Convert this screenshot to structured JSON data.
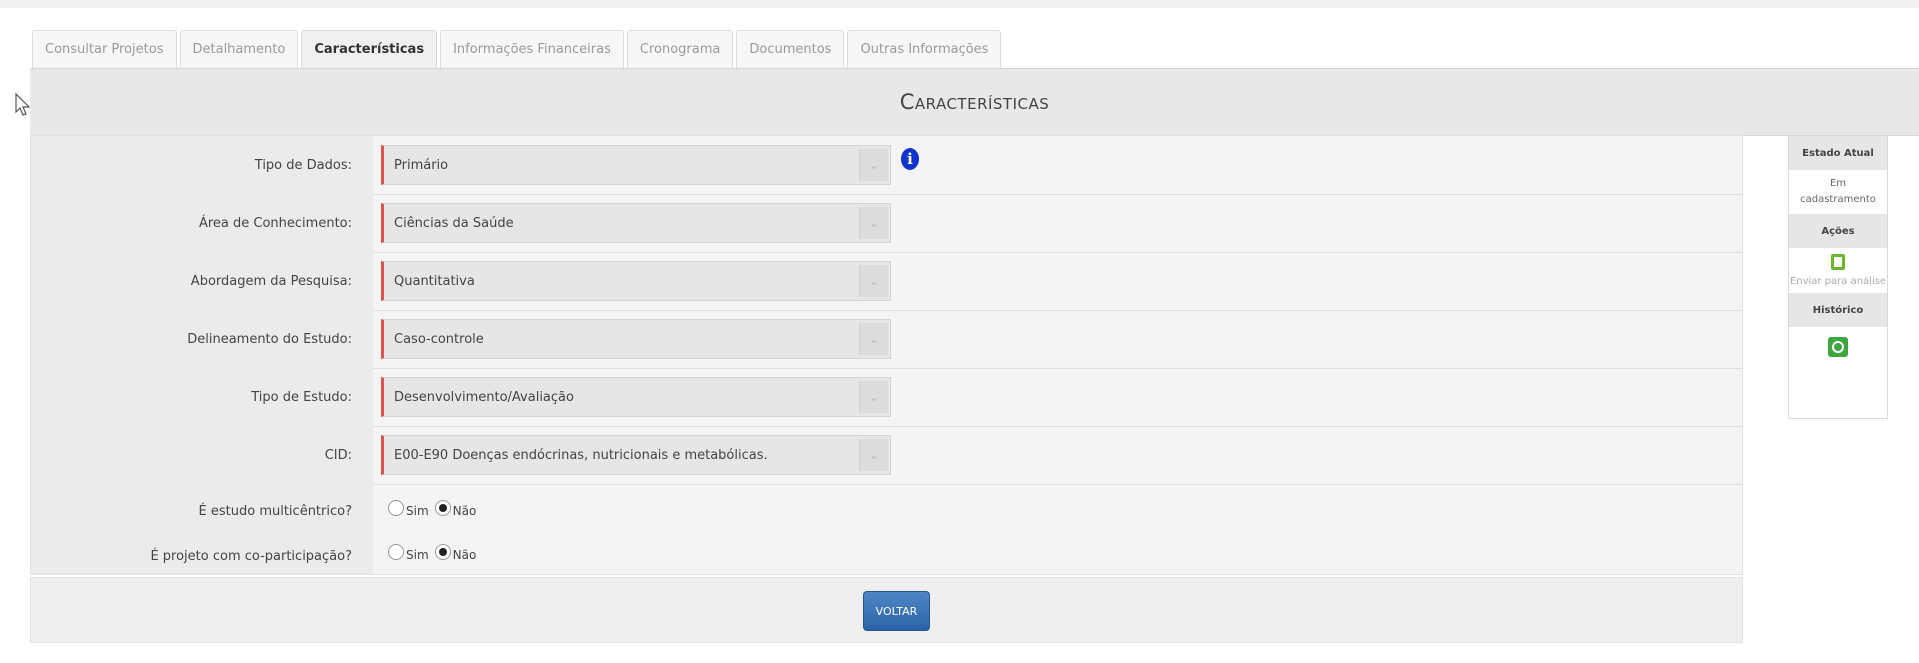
{
  "tabs": [
    {
      "label": "Consultar Projetos"
    },
    {
      "label": "Detalhamento"
    },
    {
      "label": "Características"
    },
    {
      "label": "Informações Financeiras"
    },
    {
      "label": "Cronograma"
    },
    {
      "label": "Documentos"
    },
    {
      "label": "Outras Informações"
    }
  ],
  "header": {
    "title": "Características"
  },
  "form": {
    "fields": [
      {
        "label": "Tipo de Dados:",
        "value": "Primário"
      },
      {
        "label": "Área de Conhecimento:",
        "value": "Ciências da Saúde"
      },
      {
        "label": "Abordagem da Pesquisa:",
        "value": "Quantitativa"
      },
      {
        "label": "Delineamento do Estudo:",
        "value": "Caso-controle"
      },
      {
        "label": "Tipo de Estudo:",
        "value": "Desenvolvimento/Avaliação"
      },
      {
        "label": "CID:",
        "value": "E00-E90 Doenças endócrinas, nutricionais e metabólicas."
      }
    ],
    "radios": [
      {
        "label": "É estudo multicêntrico?",
        "options": [
          "Sim",
          "Não"
        ],
        "selected": "Não"
      },
      {
        "label": "É projeto com co-participação?",
        "options": [
          "Sim",
          "Não"
        ],
        "selected": "Não"
      }
    ],
    "info_icon": "i",
    "select_arrow": "⌄"
  },
  "footer": {
    "button_label": "VOLTAR"
  },
  "sidebar": {
    "state_header": "Estado Atual",
    "state_value": "Em cadastramento",
    "actions_header": "Ações",
    "action_label": "Enviar para análise",
    "history_header": "Histórico"
  },
  "colors": {
    "required_marker": "#d9534f",
    "button": "#2b63a6",
    "info_icon": "#1133cc",
    "action_icon": "#6bb82e"
  }
}
